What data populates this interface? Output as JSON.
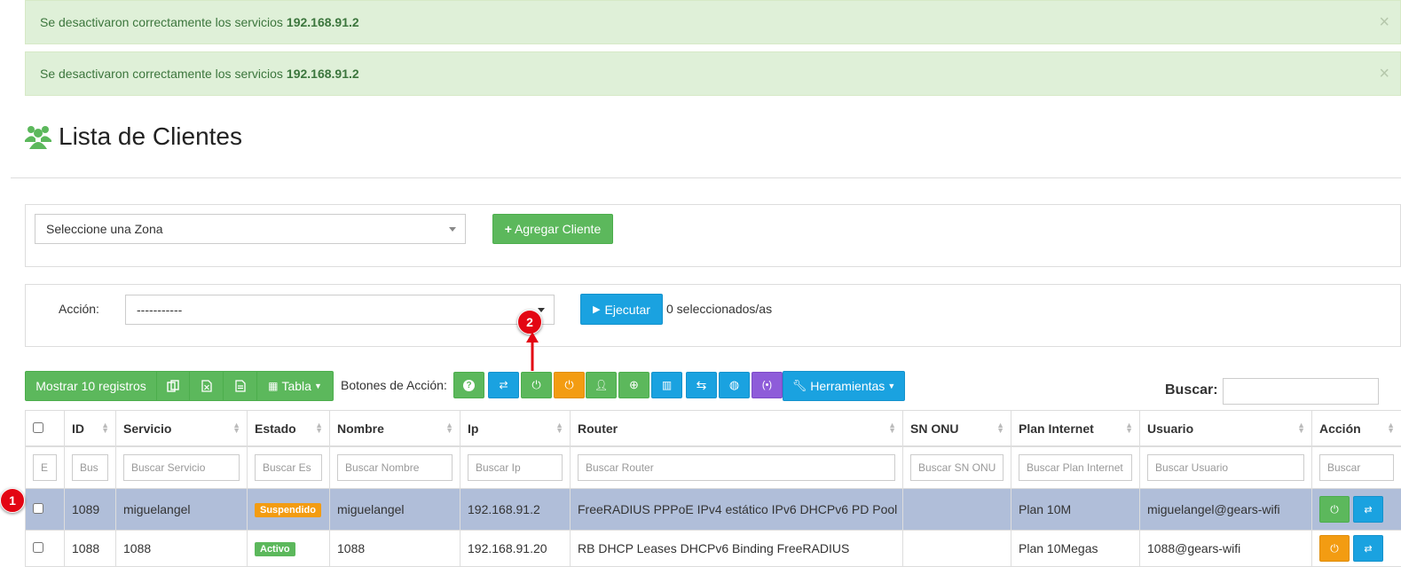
{
  "alerts": [
    {
      "text": "Se desactivaron correctamente los servicios",
      "ip": "192.168.91.2",
      "close": "×"
    },
    {
      "text": "Se desactivaron correctamente los servicios",
      "ip": "192.168.91.2",
      "close": "×"
    }
  ],
  "page_title": "Lista de Clientes",
  "zone_select": "Seleccione una Zona",
  "add_client_button": "Agregar Cliente",
  "action": {
    "label": "Acción:",
    "select_value": "-----------",
    "execute_button": "Ejecutar",
    "selected_count": "0 seleccionados/as"
  },
  "toolbar": {
    "show_records": "Mostrar 10 registros",
    "table_button": "Tabla",
    "action_buttons_label": "Botones de Acción:",
    "tools_button": "Herramientas",
    "search_label": "Buscar:"
  },
  "table": {
    "columns": [
      "ID",
      "Servicio",
      "Estado",
      "Nombre",
      "Ip",
      "Router",
      "SN ONU",
      "Plan Internet",
      "Usuario",
      "Acción"
    ],
    "filters": [
      "E",
      "Bus",
      "Buscar Servicio",
      "Buscar Es",
      "Buscar Nombre",
      "Buscar Ip",
      "Buscar Router",
      "Buscar SN ONU",
      "Buscar Plan Internet",
      "Buscar Usuario",
      "Buscar"
    ],
    "rows": [
      {
        "id": "1089",
        "servicio": "miguelangel",
        "estado": "Suspendido",
        "nombre": "miguelangel",
        "ip": "192.168.91.2",
        "router": "FreeRADIUS PPPoE IPv4 estático IPv6 DHCPv6 PD Pool",
        "sn_onu": "",
        "plan": "Plan 10M",
        "usuario": "miguelangel@gears-wifi"
      },
      {
        "id": "1088",
        "servicio": "1088",
        "estado": "Activo",
        "nombre": "1088",
        "ip": "192.168.91.20",
        "router": "RB DHCP Leases DHCPv6 Binding FreeRADIUS",
        "sn_onu": "",
        "plan": "Plan 10Megas",
        "usuario": "1088@gears-wifi"
      }
    ]
  },
  "markers": [
    "1",
    "2"
  ],
  "colors": {
    "green": "#5cb85c",
    "blue": "#1aa2e0",
    "orange": "#f39c12",
    "purple": "#8e5cd9",
    "selected_row": "#b0bed9",
    "marker_red": "#e30613"
  }
}
